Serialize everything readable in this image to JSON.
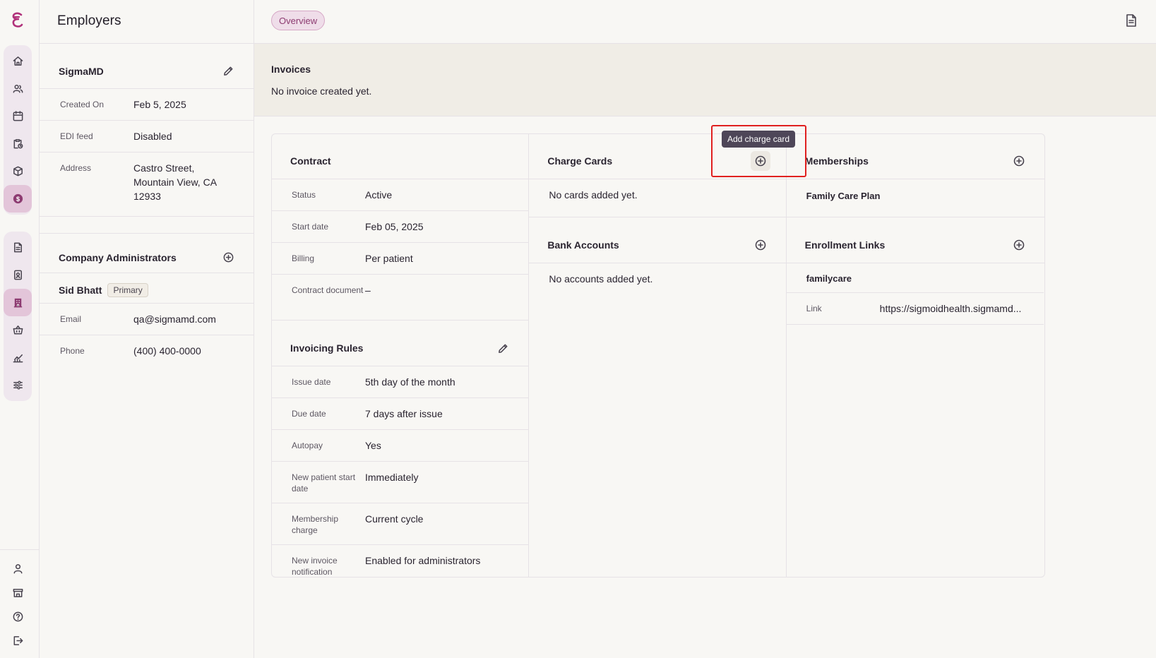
{
  "nav": {
    "items": [
      {
        "icon": "home-icon"
      },
      {
        "icon": "users-icon"
      },
      {
        "icon": "calendar-icon"
      },
      {
        "icon": "clipboard-clock-icon"
      },
      {
        "icon": "cube-icon"
      },
      {
        "icon": "dollar-icon",
        "active": true
      }
    ],
    "items2": [
      {
        "icon": "document-icon"
      },
      {
        "icon": "badge-icon"
      },
      {
        "icon": "building-icon",
        "active": true
      },
      {
        "icon": "basket-icon"
      },
      {
        "icon": "chart-icon"
      },
      {
        "icon": "sliders-icon"
      }
    ],
    "bottom": [
      {
        "icon": "user-icon"
      },
      {
        "icon": "store-icon"
      },
      {
        "icon": "help-icon"
      },
      {
        "icon": "logout-icon"
      }
    ]
  },
  "panel": {
    "title": "Employers",
    "employer": {
      "name": "SigmaMD",
      "fields": [
        {
          "label": "Created On",
          "value": "Feb 5, 2025"
        },
        {
          "label": "EDI feed",
          "value": "Disabled"
        },
        {
          "label": "Address",
          "value": "Castro Street,\nMountain View, CA\n12933"
        }
      ]
    },
    "admins": {
      "title": "Company Administrators",
      "name": "Sid Bhatt",
      "badge": "Primary",
      "fields": [
        {
          "label": "Email",
          "value": "qa@sigmamd.com"
        },
        {
          "label": "Phone",
          "value": "(400) 400-0000"
        }
      ]
    }
  },
  "main": {
    "tab": "Overview",
    "invoices": {
      "title": "Invoices",
      "empty": "No invoice created yet."
    },
    "contract": {
      "title": "Contract",
      "fields": [
        {
          "label": "Status",
          "value": "Active"
        },
        {
          "label": "Start date",
          "value": "Feb 05, 2025"
        },
        {
          "label": "Billing",
          "value": "Per patient"
        },
        {
          "label": "Contract document",
          "value": "–"
        }
      ]
    },
    "invoicing_rules": {
      "title": "Invoicing Rules",
      "fields": [
        {
          "label": "Issue date",
          "value": "5th day of the month"
        },
        {
          "label": "Due date",
          "value": "7 days after issue"
        },
        {
          "label": "Autopay",
          "value": "Yes"
        },
        {
          "label": "New patient start date",
          "value": "Immediately"
        },
        {
          "label": "Membership charge",
          "value": "Current cycle"
        },
        {
          "label": "New invoice notification",
          "value": "Enabled for administrators"
        }
      ]
    },
    "charge_cards": {
      "title": "Charge Cards",
      "empty": "No cards added yet.",
      "tooltip": "Add charge card"
    },
    "bank_accounts": {
      "title": "Bank Accounts",
      "empty": "No accounts added yet."
    },
    "memberships": {
      "title": "Memberships",
      "items": [
        "Family Care Plan"
      ]
    },
    "enrollment_links": {
      "title": "Enrollment Links",
      "name": "familycare",
      "link_label": "Link",
      "link_value": "https://sigmoidhealth.sigmamd..."
    }
  },
  "colors": {
    "accent": "#8d3b71",
    "active_bg": "#e3c5d9",
    "highlight": "#e02020"
  }
}
